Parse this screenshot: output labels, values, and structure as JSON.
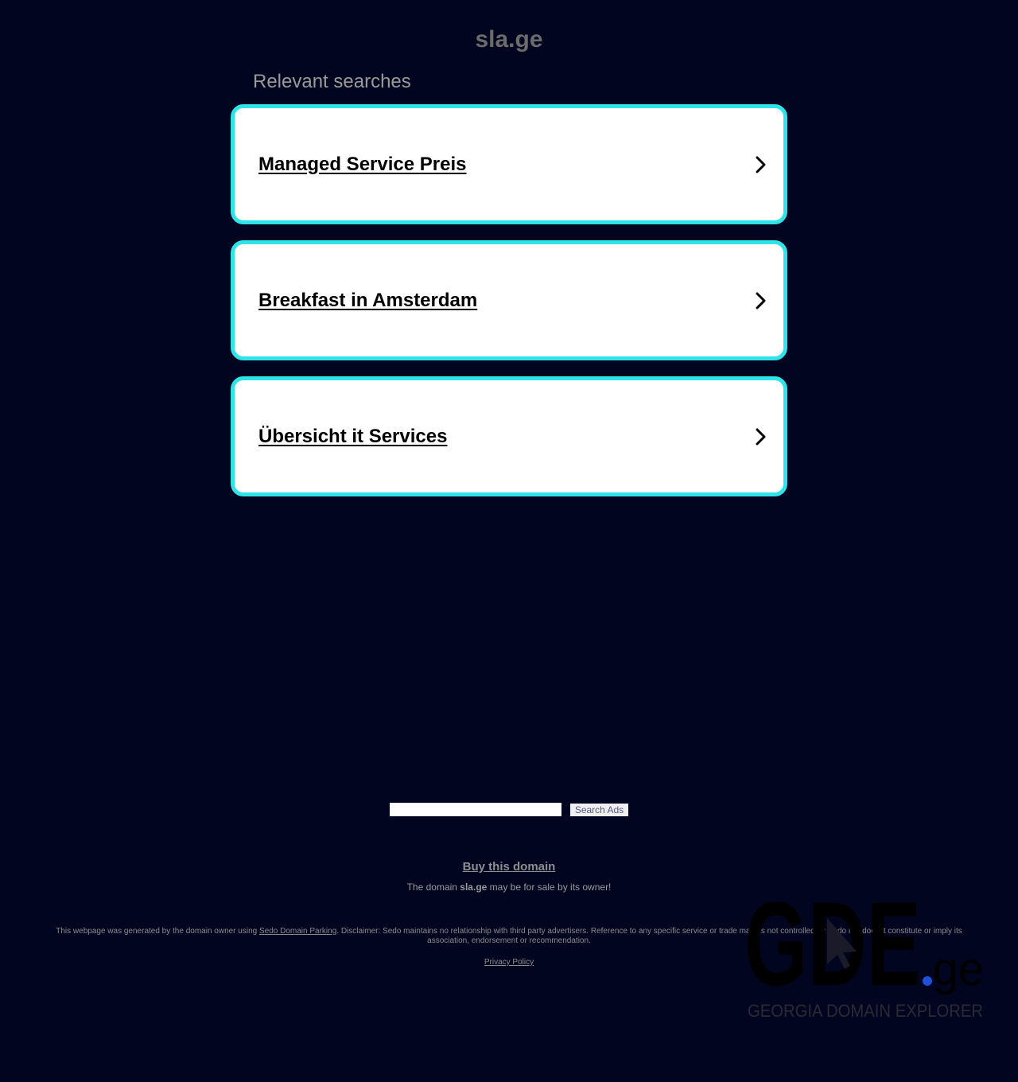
{
  "header": {
    "domain": "sla.ge",
    "relevant_label": "Relevant searches"
  },
  "searches": [
    {
      "label": "Managed Service Preis"
    },
    {
      "label": "Breakfast in Amsterdam"
    },
    {
      "label": "Übersicht it Services"
    }
  ],
  "search_bar": {
    "input_value": "",
    "button_label": "Search Ads"
  },
  "sale": {
    "buy_label": "Buy this domain",
    "text_before": "The domain ",
    "domain": "sla.ge",
    "text_after": " may be for sale by its owner!"
  },
  "footer": {
    "disclaimer_before": "This webpage was generated by the domain owner using ",
    "sedo_link": "Sedo Domain Parking",
    "disclaimer_after": ". Disclaimer: Sedo maintains no relationship with third party advertisers. Reference to any specific service or trade mark is not controlled by Sedo nor does it constitute or imply its association, endorsement or recommendation.",
    "privacy_label": "Privacy Policy"
  },
  "watermark": {
    "letters": "GDE",
    "dot": ".",
    "tld": "ge",
    "tagline": "GEORGIA DOMAIN EXPLORER",
    "colors": {
      "letters": "#000000",
      "dot": "#1f4fd6",
      "tagline": "#2a2a35"
    }
  },
  "colors": {
    "background": "#020520",
    "card_border": "#2ee4e8",
    "card_background": "#ffffff",
    "title": "#6b6b6b"
  },
  "icons": {
    "card_arrow": "chevron-right-icon"
  }
}
